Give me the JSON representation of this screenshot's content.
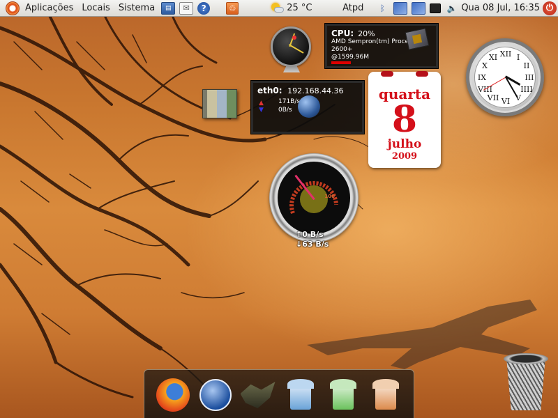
{
  "top_panel": {
    "menus": [
      "Aplicações",
      "Locais",
      "Sistema"
    ],
    "weather": {
      "temperature": "25 °C",
      "icon": "partly-cloudy-icon"
    },
    "user": "Atpd",
    "datetime": "Qua 08 Jul, 16:35",
    "tray_icons": [
      "network-icon",
      "mail-icon",
      "help-icon",
      "update-manager-icon",
      "bluetooth-icon",
      "workspace-icon",
      "workspace-icon",
      "monitor-icon",
      "volume-icon",
      "power-icon"
    ]
  },
  "cpu_widget": {
    "title": "CPU:",
    "usage": "20%",
    "processor_line1": "AMD Sempron(tm) Processor",
    "processor_line2": "2600+",
    "frequency": "@1599.96M"
  },
  "eth_widget": {
    "title": "eth0:",
    "ip": "192.168.44.36",
    "up_rate": "171B/s",
    "down_rate": "0B/s"
  },
  "calendar": {
    "weekday": "quarta",
    "day": "8",
    "month": "julho",
    "year": "2009"
  },
  "analog_clock": {
    "numerals": [
      "XII",
      "I",
      "II",
      "III",
      "IIII",
      "V",
      "VI",
      "VII",
      "VIII",
      "IX",
      "X",
      "XI"
    ]
  },
  "network_gauge": {
    "scale_max_label": "100",
    "upload": "↑0 B/s",
    "download": "↓63 B/s"
  },
  "dock": {
    "items": [
      "firefox-icon",
      "pidgin-icon",
      "gimp-icon",
      "writer-icon",
      "calc-icon",
      "impress-icon"
    ]
  },
  "desktop": {
    "trash_icon": "trash-icon",
    "folder_icon": "folder-icon"
  }
}
